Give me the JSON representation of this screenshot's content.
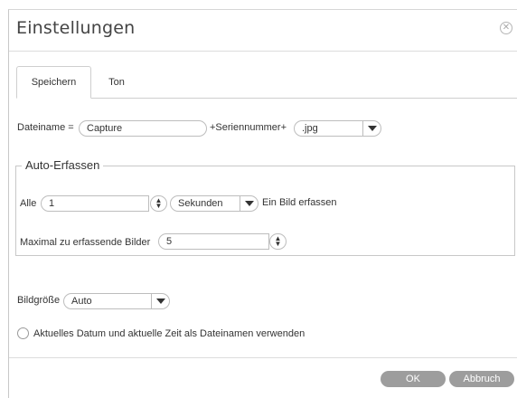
{
  "dialog": {
    "title": "Einstellungen"
  },
  "tabs": {
    "save": "Speichern",
    "sound": "Ton"
  },
  "filename": {
    "label": "Dateiname =",
    "value": "Capture",
    "separator": "+Seriennummer+",
    "extension": ".jpg"
  },
  "auto_capture": {
    "legend": "Auto-Erfassen",
    "all_label": "Alle",
    "interval_value": "1",
    "unit": "Sekunden",
    "suffix": "Ein Bild erfassen",
    "max_label": "Maximal zu erfassende Bilder",
    "max_value": "5"
  },
  "image_size": {
    "label": "Bildgröße",
    "value": "Auto"
  },
  "datetime_option": {
    "label": "Aktuelles Datum und aktuelle Zeit als Dateinamen verwenden"
  },
  "buttons": {
    "ok": "OK",
    "cancel": "Abbruch"
  },
  "colors": {
    "button_bg": "#9d9d9d",
    "border": "#c8c8c8",
    "text": "#333333"
  }
}
